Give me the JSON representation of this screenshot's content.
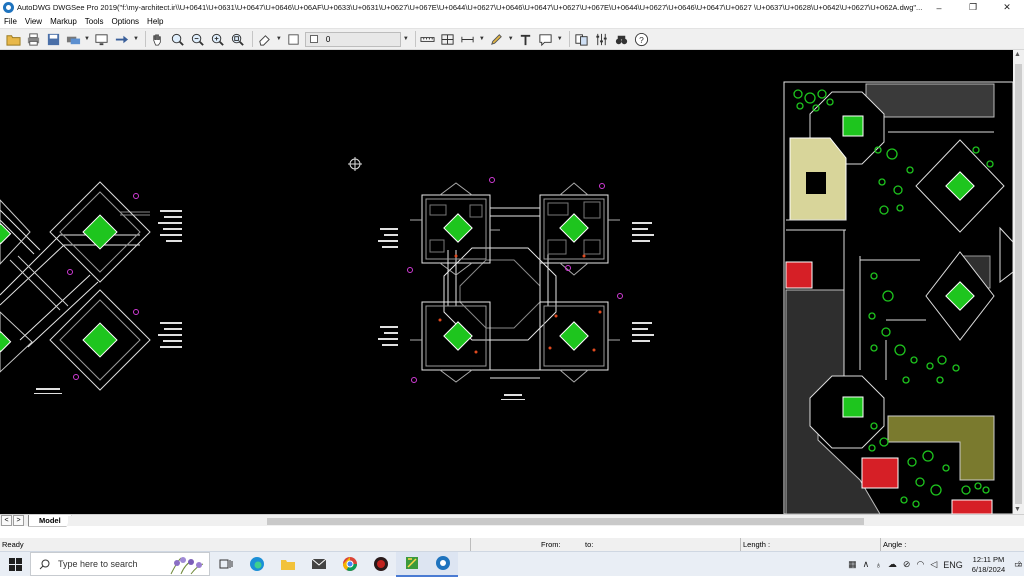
{
  "window": {
    "title": "AutoDWG DWGSee Pro 2019(\"f:\\my-architect.ir\\\\U+0641\\U+0631\\U+0647\\U+0646\\U+06AF\\U+0633\\U+0631\\U+0627\\U+067E\\U+0644\\U+0627\\U+0646\\U+0647\\U+0627\\U+067E\\U+0644\\U+0627\\U+0646\\U+0647\\U+0627 \\U+0637\\U+0628\\U+0642\\U+0627\\U+062A.dwg\"...",
    "controls": {
      "minimize": "–",
      "maximize": "❐",
      "close": "✕"
    }
  },
  "menu": [
    "File",
    "View",
    "Markup",
    "Tools",
    "Options",
    "Help"
  ],
  "toolbar": {
    "layer_value": "0"
  },
  "tabs": {
    "active": "Model",
    "prev": "<",
    "next": ">"
  },
  "status": {
    "ready": "Ready",
    "from": "From:",
    "to": "to:",
    "length": "Length :",
    "angle": "Angle :"
  },
  "taskbar": {
    "search_placeholder": "Type here to search",
    "language": "ENG",
    "time": "12:11 PM",
    "date": "6/18/2024",
    "notifications": "2"
  },
  "colors": {
    "canvas": "#000000",
    "green_fill": "#1ec51e",
    "red_block": "#d61f26",
    "olive": "#7a7a2e",
    "khaki": "#d8d59a",
    "magenta": "#d13bd6"
  }
}
